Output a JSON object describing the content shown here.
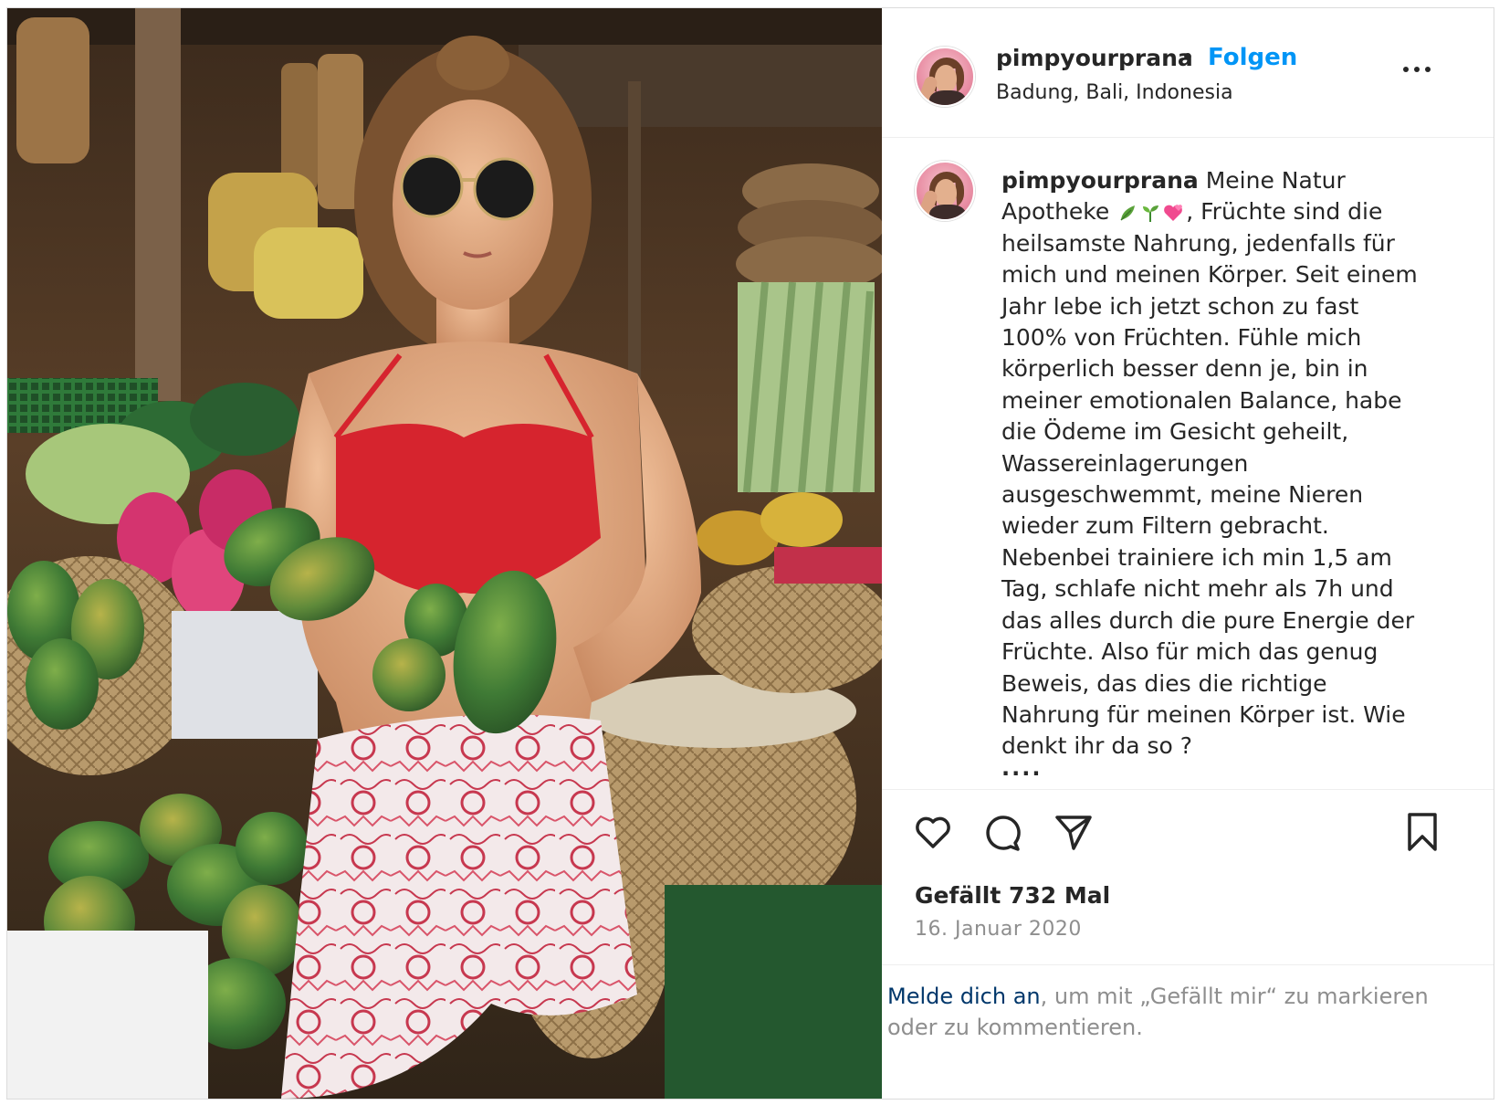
{
  "post": {
    "username": "pimpyourprana",
    "separator": "•",
    "follow_label": "Folgen",
    "location": "Badung, Bali, Indonesia",
    "more_icon": "more-horizontal-icon",
    "caption_username": "pimpyourprana",
    "caption_part1": "Meine Natur Apotheke",
    "caption_emojis": [
      "🌿",
      "🌱",
      "💕"
    ],
    "caption_part2": ", Früchte sind die heilsamste Nahrung, jedenfalls für mich und meinen Körper. Seit einem Jahr lebe ich jetzt schon zu fast 100% von Früchten. Fühle mich körperlich besser denn je, bin in meiner emotionalen Balance, habe die Ödeme im Gesicht geheilt, Wassereinlagerungen ausgeschwemmt, meine Nieren wieder zum Filtern gebracht. Nebenbei trainiere ich min 1,5 am Tag, schlafe nicht mehr als 7h und das alles durch die pure Energie der Früchte. Also für mich das genug Beweis, das dies die richtige Nahrung für meinen Körper ist. Wie denkt ihr da so ?",
    "caption_more": "....",
    "likes": "Gefällt 732 Mal",
    "date": "16. Januar 2020"
  },
  "actions": {
    "like_icon": "heart-icon",
    "comment_icon": "comment-icon",
    "share_icon": "share-icon",
    "save_icon": "bookmark-icon"
  },
  "login": {
    "link": "Melde dich an",
    "text": ", um mit „Gefällt mir“ zu markieren oder zu kommentieren."
  }
}
